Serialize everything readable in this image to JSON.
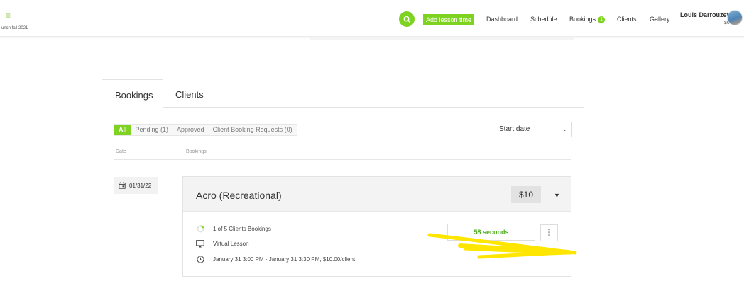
{
  "header": {
    "brand_subtitle": "unch fall 2021",
    "add_lesson_label": "Add lesson time",
    "nav": {
      "dashboard": "Dashboard",
      "schedule": "Schedule",
      "bookings": "Bookings",
      "bookings_badge": "1",
      "clients": "Clients",
      "gallery": "Gallery"
    },
    "user_name": "Louis Darrouzet",
    "user_balance": "$0.00"
  },
  "tabs": [
    "Bookings",
    "Clients"
  ],
  "filters": {
    "all": "All",
    "pending": "Pending (1)",
    "approved": "Approved",
    "requests": "Client Booking Requests (0)"
  },
  "sort_select": {
    "value": "Start date"
  },
  "columns": {
    "date": "Date",
    "bookings": "Bookings"
  },
  "booking": {
    "date": "01/31/22",
    "title": "Acro (Recreational)",
    "price": "$10",
    "clients_line": "1 of 5 Clients Bookings",
    "lesson_type": "Virtual Lesson",
    "schedule_line": "January 31 3:00 PM - January 31 3:30 PM, $10.00/client",
    "timer": "58 seconds",
    "booked_fraction": 0.2
  },
  "colors": {
    "accent": "#7ed321",
    "timer_text": "#4caf20",
    "annotation": "#ffe600"
  }
}
